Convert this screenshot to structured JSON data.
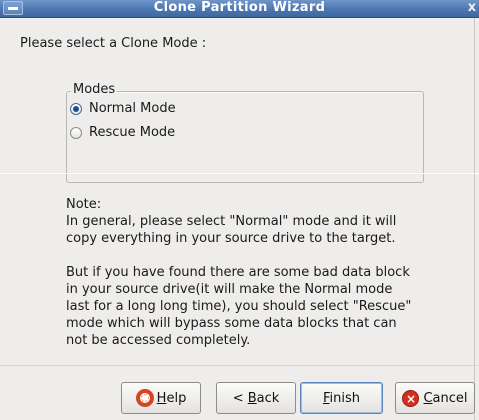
{
  "window": {
    "title": "Clone Partition Wizard",
    "close_glyph": "x"
  },
  "prompt": "Please select a Clone Mode :",
  "modes": {
    "legend": "Modes",
    "options": [
      {
        "label": "Normal Mode",
        "selected": true
      },
      {
        "label": "Rescue Mode",
        "selected": false
      }
    ]
  },
  "note": {
    "heading": "Note:",
    "para1_lines": [
      "In general, please select \"Normal\" mode and it will",
      "copy everything in your source drive to the target."
    ],
    "para2_lines": [
      "But if you have found there are some bad data block",
      "in your source drive(it will make the Normal mode",
      "last for a long long time), you should select \"Rescue\"",
      "mode which will bypass some data blocks that can",
      "not be accessed completely."
    ]
  },
  "buttons": {
    "help": {
      "mnemonic": "H",
      "rest": "elp",
      "icon": "lifebuoy-icon"
    },
    "back": {
      "prefix": "< ",
      "mnemonic": "B",
      "rest": "ack"
    },
    "finish": {
      "mnemonic": "F",
      "rest": "inish"
    },
    "cancel": {
      "mnemonic": "C",
      "rest": "ancel",
      "icon": "cancel-icon"
    }
  },
  "colors": {
    "titlebar": "#4d77b1",
    "window_bg": "#eeedeb",
    "radio_selected": "#1f4f8f",
    "cancel_icon": "#d0301d"
  }
}
